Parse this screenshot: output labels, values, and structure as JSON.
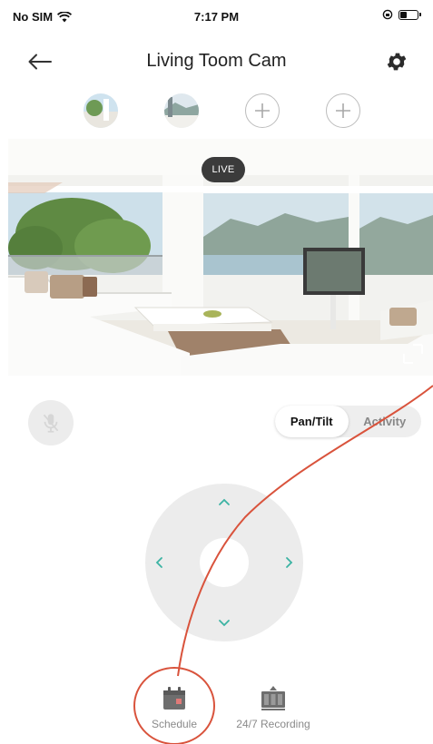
{
  "status_bar": {
    "carrier": "No SIM",
    "time": "7:17 PM"
  },
  "header": {
    "title": "Living Toom Cam"
  },
  "live_view": {
    "badge": "LIVE"
  },
  "controls": {
    "modes": [
      "Pan/Tilt",
      "Activity"
    ],
    "active_mode": "Pan/Tilt"
  },
  "bottom_bar": {
    "items": [
      {
        "label": "Schedule",
        "icon": "calendar-icon"
      },
      {
        "label": "24/7 Recording",
        "icon": "recording-icon"
      }
    ]
  },
  "colors": {
    "accent": "#3bb3a3",
    "annotation": "#d9533c",
    "schedule_icon": "#6e6e6e",
    "schedule_icon_mark": "#e07a78"
  }
}
